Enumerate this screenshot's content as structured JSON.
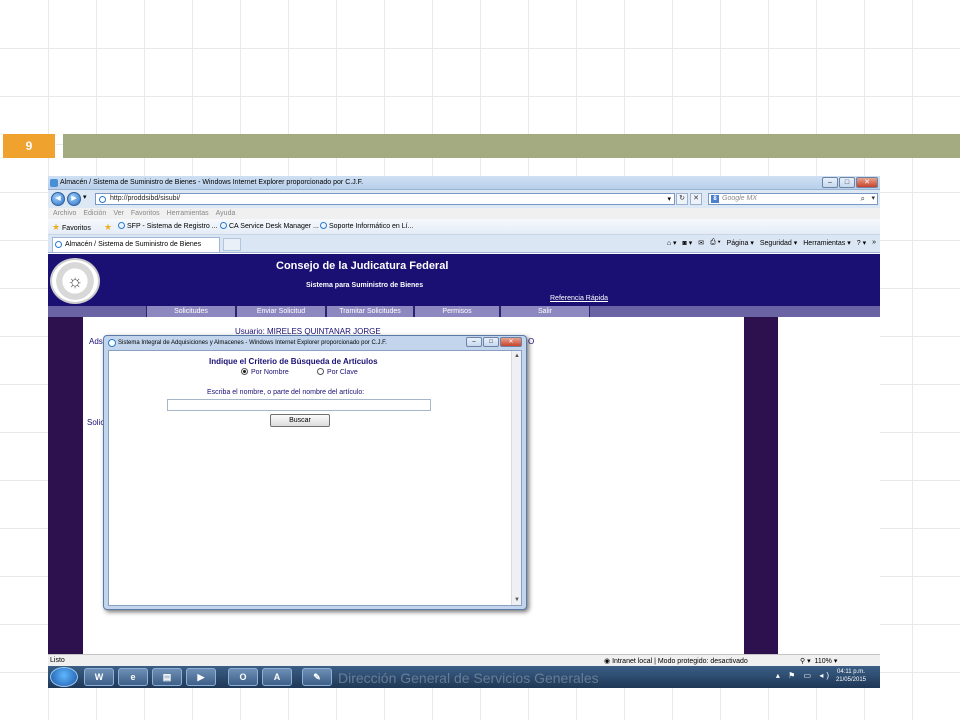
{
  "slide": {
    "number": "9"
  },
  "browser": {
    "title": "Almacén / Sistema de Suministro de Bienes - Windows Internet Explorer proporcionado por C.J.F.",
    "url": "http://proddsibd/sisubi/",
    "search_placeholder": "Google MX",
    "menu": [
      "Archivo",
      "Edición",
      "Ver",
      "Favoritos",
      "Herramientas",
      "Ayuda"
    ],
    "favorites": {
      "label": "Favoritos",
      "items": [
        "SFP - Sistema de Registro ...",
        "CA Service Desk Manager ...",
        "Soporte Informático en Lí..."
      ]
    },
    "tab_title": "Almacén / Sistema de Suministro de Bienes",
    "commands": [
      "Página ▾",
      "Seguridad ▾",
      "Herramientas ▾"
    ]
  },
  "site": {
    "title": "Consejo de la Judicatura Federal",
    "subtitle": "Sistema para Suministro de Bienes",
    "quick_ref": "Referencia Rápida",
    "nav": [
      "Solicitudes",
      "Enviar Solicitud",
      "Tramitar Solicitudes",
      "Permisos",
      "Salir"
    ],
    "user_line": "Usuario:  MIRELES QUINTANAR JORGE",
    "left_fragment_1": "Ads",
    "left_fragment_2": "Solici",
    "right_fragment": "O"
  },
  "popup": {
    "title": "Sistema Integral de Adquisiciones y Almacenes - Windows Internet Explorer proporcionado por C.J.F.",
    "heading": "Indique el Criterio de Búsqueda de Artículos",
    "option_nombre": "Por Nombre",
    "option_clave": "Por Clave",
    "selected": "Por Nombre",
    "instruction": "Escriba el nombre, o parte del nombre del artículo:",
    "search_value": "",
    "button": "Buscar"
  },
  "status": {
    "left": "Listo",
    "zone": "Intranet local | Modo protegido: desactivado",
    "zoom": "110%"
  },
  "taskbar": {
    "watermark": "Dirección General de Servicios Generales",
    "time": "04:11 p.m.",
    "date": "21/05/2015"
  },
  "colors": {
    "slide_number_bg": "#f0a22e",
    "slide_band": "#a5ab81",
    "site_header": "#1a1073",
    "side_columns": "#2d104e",
    "nav_bar": "#8e88c0"
  }
}
